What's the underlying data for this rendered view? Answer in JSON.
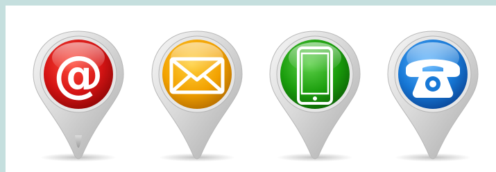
{
  "image": {
    "background_color": "#ffffff",
    "frame_color": "#c5dfde",
    "pins": [
      {
        "icon": "at-sign-icon",
        "color": "#d51414",
        "highlight": "#ff5a4a",
        "label": "@"
      },
      {
        "icon": "envelope-icon",
        "color": "#f2a100",
        "highlight": "#ffd04a"
      },
      {
        "icon": "smartphone-icon",
        "color": "#1a9d0c",
        "highlight": "#5ed14a"
      },
      {
        "icon": "telephone-icon",
        "color": "#1778d6",
        "highlight": "#5fb6ff"
      }
    ]
  }
}
